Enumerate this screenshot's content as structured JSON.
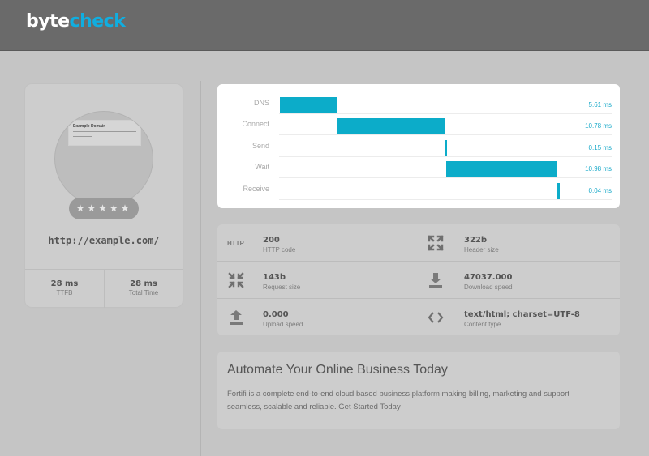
{
  "brand": {
    "part1": "byte",
    "part2": "check"
  },
  "site": {
    "thumbnail_title": "Example Domain",
    "stars": "★★★★★",
    "url": "http://example.com/",
    "metrics": [
      {
        "value": "28 ms",
        "label": "TTFB"
      },
      {
        "value": "28 ms",
        "label": "Total Time"
      }
    ]
  },
  "timing": [
    {
      "label": "DNS",
      "ms": "5.61 ms",
      "start_ms": 0.0,
      "duration_ms": 5.61
    },
    {
      "label": "Connect",
      "ms": "10.78 ms",
      "start_ms": 5.61,
      "duration_ms": 10.78
    },
    {
      "label": "Send",
      "ms": "0.15 ms",
      "start_ms": 16.39,
      "duration_ms": 0.15
    },
    {
      "label": "Wait",
      "ms": "10.98 ms",
      "start_ms": 16.54,
      "duration_ms": 10.98
    },
    {
      "label": "Receive",
      "ms": "0.04 ms",
      "start_ms": 27.52,
      "duration_ms": 0.04
    }
  ],
  "info": [
    {
      "icon": "http-icon",
      "icon_text": "HTTP",
      "value": "200",
      "label": "HTTP code"
    },
    {
      "icon": "expand-icon",
      "value": "322b",
      "label": "Header size"
    },
    {
      "icon": "compress-icon",
      "value": "143b",
      "label": "Request size"
    },
    {
      "icon": "download-icon",
      "value": "47037.000",
      "label": "Download speed"
    },
    {
      "icon": "upload-icon",
      "value": "0.000",
      "label": "Upload speed"
    },
    {
      "icon": "code-icon",
      "value": "text/html; charset=UTF-8",
      "label": "Content type"
    }
  ],
  "ad": {
    "title": "Automate Your Online Business Today",
    "body": "Fortifi is a complete end-to-end cloud based business platform making billing, marketing and support seamless, scalable and reliable.",
    "link": "Get Started Today"
  },
  "colors": {
    "accent": "#0cacc9",
    "topbar": "#6a6a6a",
    "background": "#c5c5c5"
  }
}
